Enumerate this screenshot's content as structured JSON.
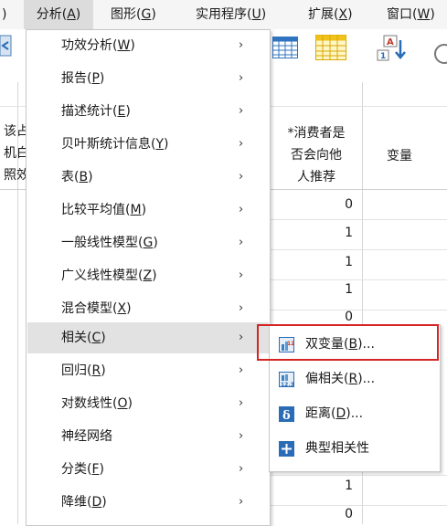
{
  "menubar": {
    "items": [
      {
        "label": ")"
      },
      {
        "label": "分析(A)",
        "pre": "分析(",
        "key": "A",
        "post": ")"
      },
      {
        "label": "图形(G)",
        "pre": "图形(",
        "key": "G",
        "post": ")"
      },
      {
        "label": "实用程序(U)",
        "pre": "实用程序(",
        "key": "U",
        "post": ")"
      },
      {
        "label": "扩展(X)",
        "pre": "扩展(",
        "key": "X",
        "post": ")"
      },
      {
        "label": "窗口(W)",
        "pre": "窗口(",
        "key": "W",
        "post": ")"
      }
    ]
  },
  "grid": {
    "left_partial": [
      "该占",
      "机白",
      "照效"
    ],
    "column_header": [
      "*消费者是",
      "否会向他",
      "人推荐"
    ],
    "column_header_2": "变量",
    "values": [
      "0",
      "1",
      "1",
      "1",
      "0",
      "1",
      "0"
    ]
  },
  "menu": {
    "items": [
      {
        "pre": "功效分析(",
        "key": "W",
        "post": ")",
        "arrow": "›"
      },
      {
        "pre": "报告(",
        "key": "P",
        "post": ")",
        "arrow": "›"
      },
      {
        "pre": "描述统计(",
        "key": "E",
        "post": ")",
        "arrow": "›"
      },
      {
        "pre": "贝叶斯统计信息(",
        "key": "Y",
        "post": ")",
        "arrow": "›"
      },
      {
        "pre": "表(",
        "key": "B",
        "post": ")",
        "arrow": "›"
      },
      {
        "pre": "比较平均值(",
        "key": "M",
        "post": ")",
        "arrow": "›"
      },
      {
        "pre": "一般线性模型(",
        "key": "G",
        "post": ")",
        "arrow": "›"
      },
      {
        "pre": "广义线性模型(",
        "key": "Z",
        "post": ")",
        "arrow": "›"
      },
      {
        "pre": "混合模型(",
        "key": "X",
        "post": ")",
        "arrow": "›"
      },
      {
        "pre": "相关(",
        "key": "C",
        "post": ")",
        "arrow": "›"
      },
      {
        "pre": "回归(",
        "key": "R",
        "post": ")",
        "arrow": "›"
      },
      {
        "pre": "对数线性(",
        "key": "O",
        "post": ")",
        "arrow": "›"
      },
      {
        "pre": "神经网络",
        "key": "",
        "post": "",
        "arrow": "›"
      },
      {
        "pre": "分类(",
        "key": "F",
        "post": ")",
        "arrow": "›"
      },
      {
        "pre": "降维(",
        "key": "D",
        "post": ")",
        "arrow": "›"
      }
    ],
    "highlighted_index": 9
  },
  "submenu": {
    "items": [
      {
        "pre": "双变量(",
        "key": "B",
        "post": ")...",
        "icon": "bivariate-icon"
      },
      {
        "pre": "偏相关(",
        "key": "R",
        "post": ")...",
        "icon": "partial-correlation-icon"
      },
      {
        "pre": "距离(",
        "key": "D",
        "post": ")...",
        "icon": "distance-icon"
      },
      {
        "pre": "典型相关性",
        "key": "",
        "post": "",
        "icon": "canonical-correlation-icon"
      }
    ]
  },
  "colors": {
    "highlight_box": "#d42424",
    "menu_highlight": "#e2e2e2",
    "icon_blue": "#2a6cb5"
  }
}
